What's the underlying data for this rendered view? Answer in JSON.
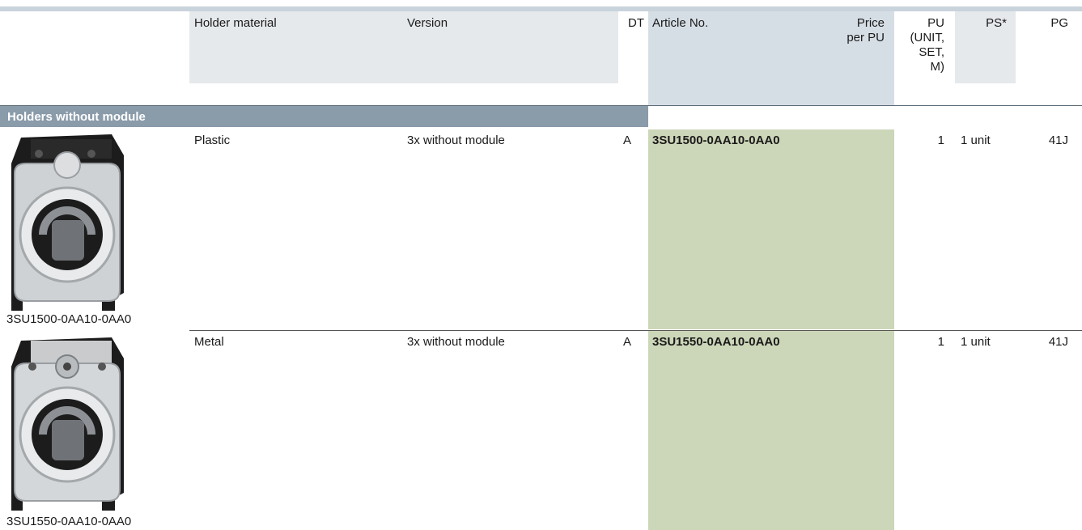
{
  "headers": {
    "holder_material": "Holder material",
    "version": "Version",
    "dt": "DT",
    "article_no": "Article No.",
    "price_line1": "Price",
    "price_line2": "per PU",
    "pu_line1": "PU",
    "pu_line2": "(UNIT,",
    "pu_line3": "SET,",
    "pu_line4": "M)",
    "ps": "PS*",
    "pg": "PG"
  },
  "section": {
    "title": "Holders without module"
  },
  "rows": [
    {
      "material": "Plastic",
      "version": "3x without module",
      "dt": "A",
      "article": "3SU1500-0AA10-0AA0",
      "pu": "1",
      "ps": "1 unit",
      "pg": "41J",
      "caption": "3SU1500-0AA10-0AA0",
      "image_icon": "plastic-holder-image"
    },
    {
      "material": "Metal",
      "version": "3x without module",
      "dt": "A",
      "article": "3SU1550-0AA10-0AA0",
      "pu": "1",
      "ps": "1 unit",
      "pg": "41J",
      "caption": "3SU1550-0AA10-0AA0",
      "image_icon": "metal-holder-image"
    }
  ],
  "colors": {
    "header_bg": "#e6e9ec",
    "article_header_bg": "#d6dee5",
    "section_bar": "#8a9baa",
    "article_cell_bg": "#ccd6b8"
  }
}
